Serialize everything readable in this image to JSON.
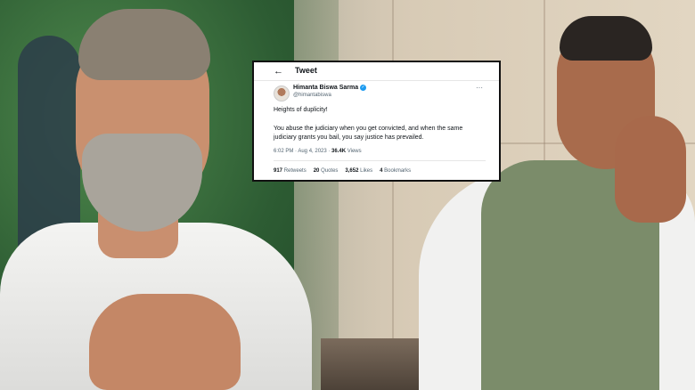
{
  "tweet": {
    "header_title": "Tweet",
    "author_name": "Himanta Biswa Sarma",
    "author_handle": "@himantabiswa",
    "line1": "Heights of duplicity!",
    "line2": "You abuse the judiciary when you get convicted, and when the same judiciary grants you bail, you say justice has prevailed.",
    "timestamp": "6:02 PM · Aug 4, 2023 · ",
    "views_count": "36.4K",
    "views_label": " Views",
    "stats": [
      {
        "count": "917",
        "label": "Retweets"
      },
      {
        "count": "20",
        "label": "Quotes"
      },
      {
        "count": "3,652",
        "label": "Likes"
      },
      {
        "count": "4",
        "label": "Bookmarks"
      }
    ],
    "icons": {
      "back": "back-arrow-icon",
      "verified": "verified-badge-icon",
      "more": "more-options-icon"
    },
    "colors": {
      "verified": "#1d9bf0",
      "text": "#0f1419",
      "muted": "#536471"
    }
  }
}
